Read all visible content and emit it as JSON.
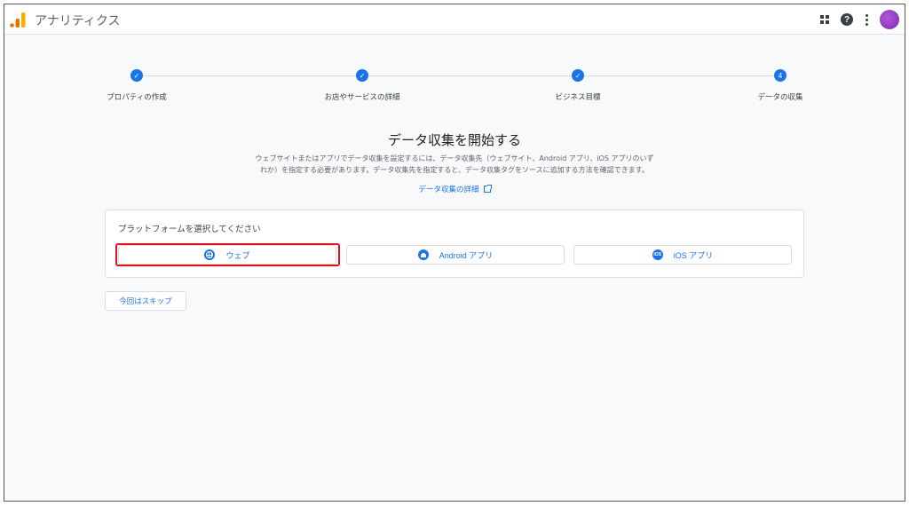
{
  "app": {
    "title": "アナリティクス"
  },
  "header_icons": [
    "apps-icon",
    "help-icon",
    "more-vert-icon",
    "avatar"
  ],
  "stepper": {
    "steps": [
      {
        "label": "プロパティの作成",
        "state": "done",
        "mark": "✓"
      },
      {
        "label": "お店やサービスの詳細",
        "state": "done",
        "mark": "✓"
      },
      {
        "label": "ビジネス目標",
        "state": "done",
        "mark": "✓"
      },
      {
        "label": "データの収集",
        "state": "current",
        "mark": "4"
      }
    ]
  },
  "main": {
    "heading": "データ収集を開始する",
    "description_line1": "ウェブサイトまたはアプリでデータ収集を設定するには、データ収集先（ウェブサイト、Android アプリ、iOS アプリのいず",
    "description_line2": "れか）を指定する必要があります。データ収集先を指定すると、データ収集タグをソースに追加する方法を確認できます。",
    "learn_more": "データ収集の詳細"
  },
  "platform_card": {
    "title": "プラットフォームを選択してください",
    "options": [
      {
        "label": "ウェブ",
        "icon": "globe-icon",
        "selected": true
      },
      {
        "label": "Android アプリ",
        "icon": "android-icon",
        "selected": false
      },
      {
        "label": "iOS アプリ",
        "icon": "ios-icon",
        "icon_text": "iOS",
        "selected": false
      }
    ]
  },
  "skip_button": "今回はスキップ",
  "colors": {
    "accent": "#1a73e8",
    "highlight": "#e0121c",
    "background": "#f8f9fa",
    "logo_orange": "#f9ab00",
    "logo_dark_orange": "#e37400"
  }
}
